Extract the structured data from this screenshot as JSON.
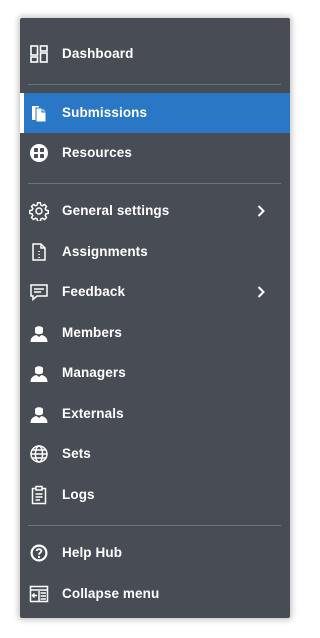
{
  "menu": {
    "items": [
      {
        "label": "Dashboard",
        "icon": "dashboard-icon"
      },
      {
        "label": "Submissions",
        "icon": "submissions-icon",
        "active": true
      },
      {
        "label": "Resources",
        "icon": "resources-icon"
      },
      {
        "label": "General settings",
        "icon": "gear-icon",
        "has_submenu": true
      },
      {
        "label": "Assignments",
        "icon": "assignment-document-icon"
      },
      {
        "label": "Feedback",
        "icon": "feedback-speech-bubble-icon",
        "has_submenu": true
      },
      {
        "label": "Members",
        "icon": "person-icon"
      },
      {
        "label": "Managers",
        "icon": "person-icon"
      },
      {
        "label": "Externals",
        "icon": "person-icon"
      },
      {
        "label": "Sets",
        "icon": "globe-icon"
      },
      {
        "label": "Logs",
        "icon": "clipboard-icon"
      },
      {
        "label": "Help Hub",
        "icon": "help-question-icon"
      },
      {
        "label": "Collapse menu",
        "icon": "collapse-menu-icon"
      }
    ]
  },
  "colors": {
    "background": "#474c55",
    "active": "#2a78c5",
    "text": "#ffffff",
    "divider": "#6d727b"
  }
}
